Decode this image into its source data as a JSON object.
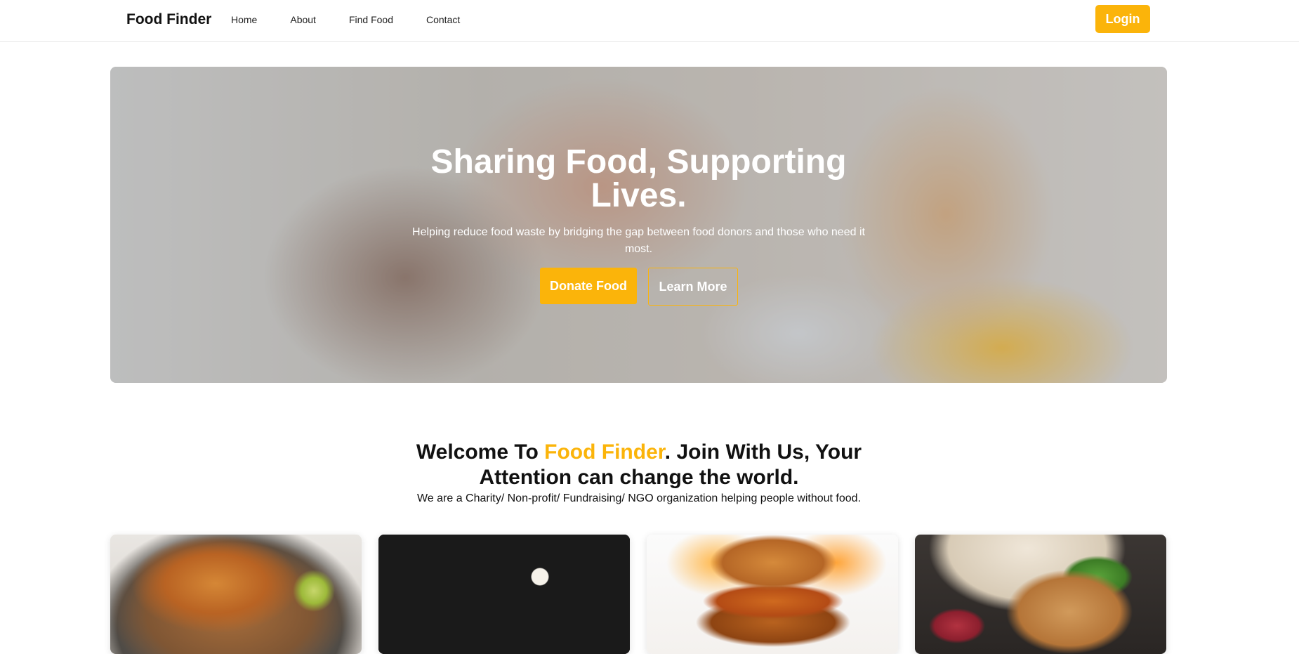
{
  "nav": {
    "brand": "Food Finder",
    "links": [
      "Home",
      "About",
      "Find Food",
      "Contact"
    ],
    "login_label": "Login"
  },
  "hero": {
    "title": "Sharing Food, Supporting Lives.",
    "subtitle": "Helping reduce food waste by bridging the gap between food donors and those who need it most.",
    "donate_label": "Donate Food",
    "learn_label": "Learn More"
  },
  "welcome": {
    "title_prefix": "Welcome To ",
    "title_brand": "Food Finder",
    "title_suffix": ". Join With Us, Your Attention can change the world.",
    "subtitle": "We are a Charity/ Non-profit/ Fundraising/ NGO organization helping people without food."
  },
  "colors": {
    "accent": "#fbb40a"
  }
}
